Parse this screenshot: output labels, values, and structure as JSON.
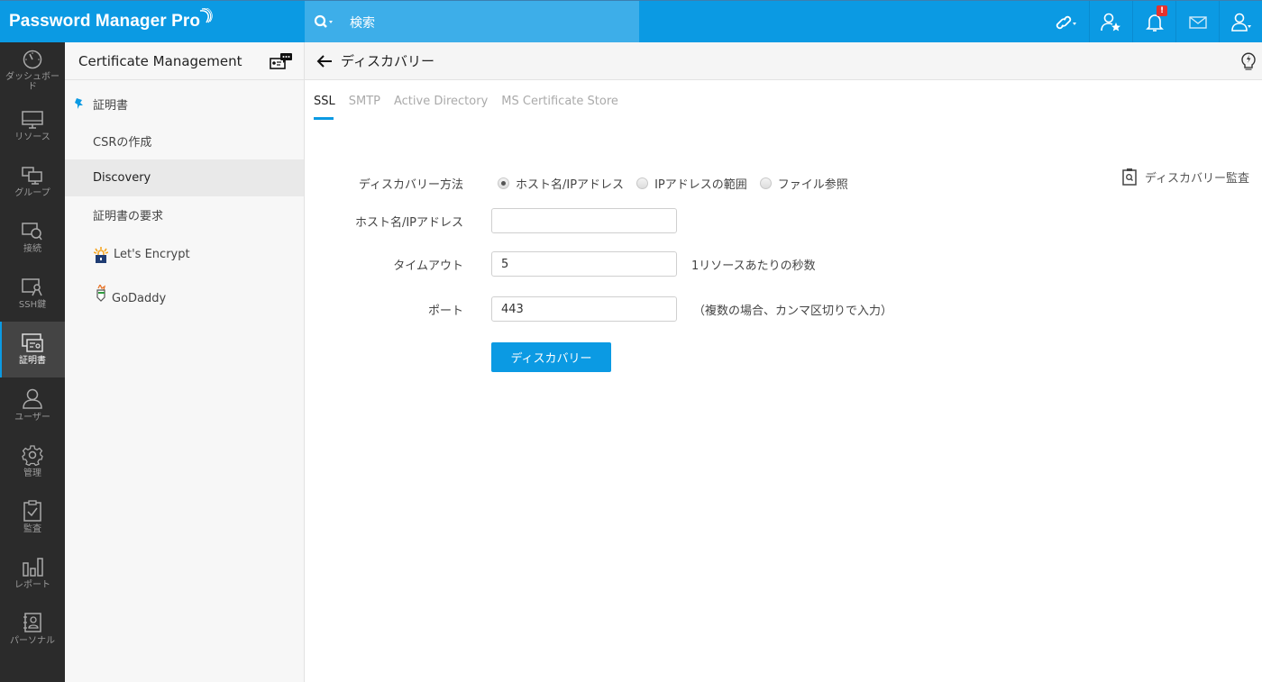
{
  "app": {
    "title": "Password Manager Pro"
  },
  "search": {
    "placeholder": "検索"
  },
  "topbar": {
    "icons": [
      "link-icon",
      "user-star-icon",
      "bell-icon",
      "mail-icon",
      "user-icon"
    ],
    "notification_badge": "!"
  },
  "leftnav": {
    "items": [
      {
        "label": "ダッシュボード",
        "icon": "dashboard-icon",
        "active": false
      },
      {
        "label": "リソース",
        "icon": "monitor-icon",
        "active": false
      },
      {
        "label": "グループ",
        "icon": "group-icon",
        "active": false
      },
      {
        "label": "接続",
        "icon": "connection-icon",
        "active": false
      },
      {
        "label": "SSH鍵",
        "icon": "ssh-key-icon",
        "active": false
      },
      {
        "label": "証明書",
        "icon": "certificate-icon",
        "active": true
      },
      {
        "label": "ユーザー",
        "icon": "user-icon",
        "active": false
      },
      {
        "label": "管理",
        "icon": "gear-icon",
        "active": false
      },
      {
        "label": "監査",
        "icon": "clipboard-check-icon",
        "active": false
      },
      {
        "label": "レポート",
        "icon": "bar-chart-icon",
        "active": false
      },
      {
        "label": "パーソナル",
        "icon": "personal-icon",
        "active": false
      }
    ]
  },
  "subnav": {
    "title": "Certificate Management",
    "items": [
      {
        "label": "証明書",
        "pinned": true
      },
      {
        "label": "CSRの作成"
      },
      {
        "label": "Discovery",
        "active": true
      },
      {
        "label": "証明書の要求"
      },
      {
        "label": "Let's Encrypt",
        "icon": "lets-encrypt-logo"
      },
      {
        "label": "GoDaddy",
        "icon": "godaddy-logo"
      }
    ]
  },
  "main": {
    "title": "ディスカバリー",
    "tabs": [
      {
        "label": "SSL",
        "active": true
      },
      {
        "label": "SMTP"
      },
      {
        "label": "Active Directory"
      },
      {
        "label": "MS Certificate Store"
      }
    ],
    "audit_link": "ディスカバリー監査",
    "form": {
      "method_label": "ディスカバリー方法",
      "methods": [
        {
          "label": "ホスト名/IPアドレス",
          "checked": true
        },
        {
          "label": "IPアドレスの範囲",
          "checked": false
        },
        {
          "label": "ファイル参照",
          "checked": false
        }
      ],
      "host_label": "ホスト名/IPアドレス",
      "host_value": "",
      "timeout_label": "タイムアウト",
      "timeout_value": "5",
      "timeout_hint": "1リソースあたりの秒数",
      "port_label": "ポート",
      "port_value": "443",
      "port_hint": "（複数の場合、カンマ区切りで入力）",
      "submit_label": "ディスカバリー"
    }
  },
  "colors": {
    "accent": "#0b9ae3",
    "nav_bg": "#2b2b2b",
    "search_bg": "#3daee9"
  }
}
